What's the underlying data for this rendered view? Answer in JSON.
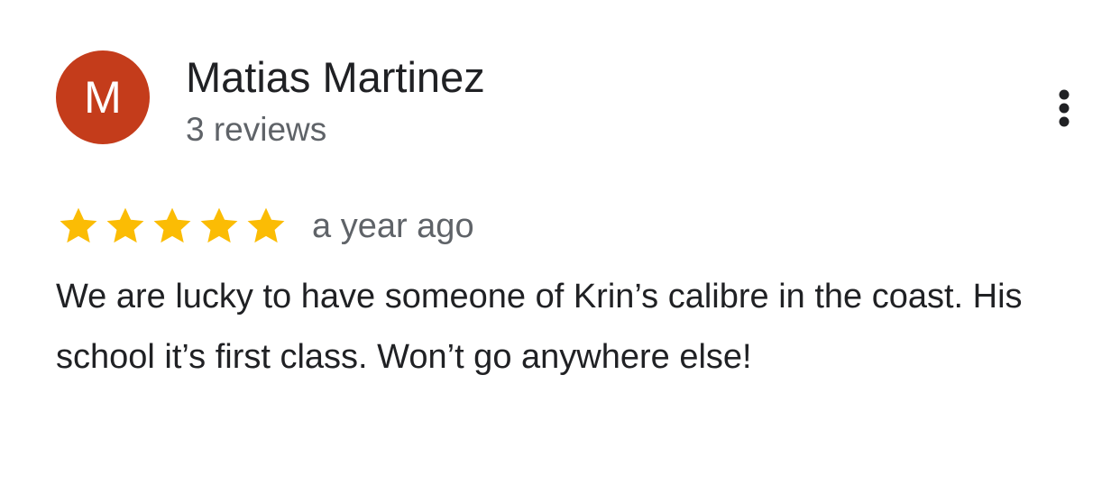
{
  "reviewer": {
    "avatar_letter": "M",
    "avatar_color": "#c43c1b",
    "name": "Matias Martinez",
    "review_count": "3 reviews"
  },
  "more_options": {
    "icon": "more-vert-icon"
  },
  "review": {
    "rating": 5,
    "rating_max": 5,
    "star_color": "#fbbc04",
    "time": "a year ago",
    "text": "We are lucky to have someone of Krin’s calibre in the coast. His school it’s first class. Won’t go anywhere else!"
  }
}
